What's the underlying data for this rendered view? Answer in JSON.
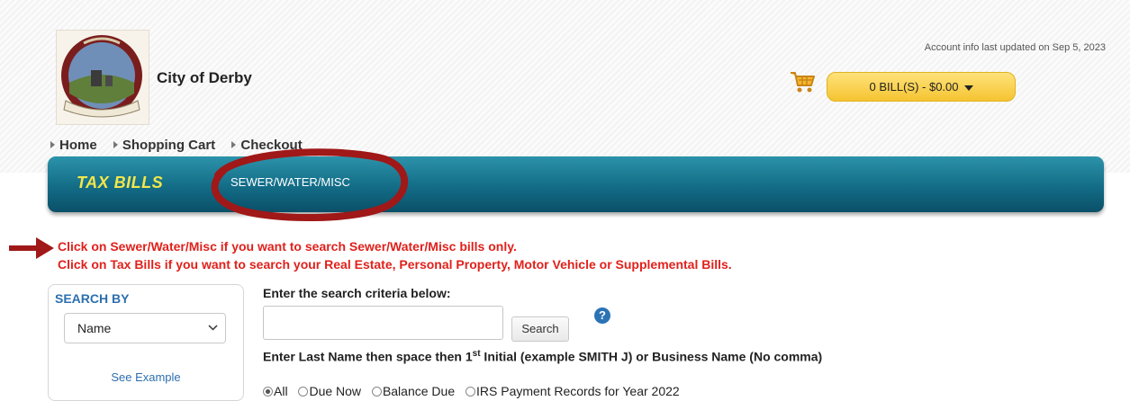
{
  "header": {
    "city_name": "City of Derby",
    "updated_text": "Account info last updated on Sep 5, 2023",
    "cart_label": "0 BILL(S) - $0.00"
  },
  "breadcrumb": [
    "Home",
    "Shopping Cart",
    "Checkout"
  ],
  "nav": {
    "tax_bills": "TAX BILLS",
    "sewer": "SEWER/WATER/MISC"
  },
  "notice": {
    "line1": "Click on Sewer/Water/Misc if you want to search Sewer/Water/Misc bills only.",
    "line2": "Click on Tax Bills if you want to search your Real Estate, Personal Property, Motor Vehicle or Supplemental Bills."
  },
  "search_by": {
    "title": "SEARCH BY",
    "selected": "Name",
    "see_example": "See Example"
  },
  "search": {
    "criteria_label": "Enter the search criteria below:",
    "input_value": "",
    "button": "Search",
    "help": "?",
    "instr_before": "Enter Last Name then space then 1",
    "instr_sup": "st",
    "instr_after": " Initial (example SMITH J) or Business Name (No comma)"
  },
  "filters": [
    {
      "label": "All",
      "checked": true
    },
    {
      "label": "Due Now",
      "checked": false
    },
    {
      "label": "Balance Due",
      "checked": false
    },
    {
      "label": "IRS Payment Records for Year 2022",
      "checked": false
    }
  ],
  "colors": {
    "notice_red": "#e0211c",
    "nav_teal": "#136c86",
    "tab_yellow": "#f4e64a",
    "cart_yellow": "#f5c431",
    "annotation": "#a01818"
  }
}
